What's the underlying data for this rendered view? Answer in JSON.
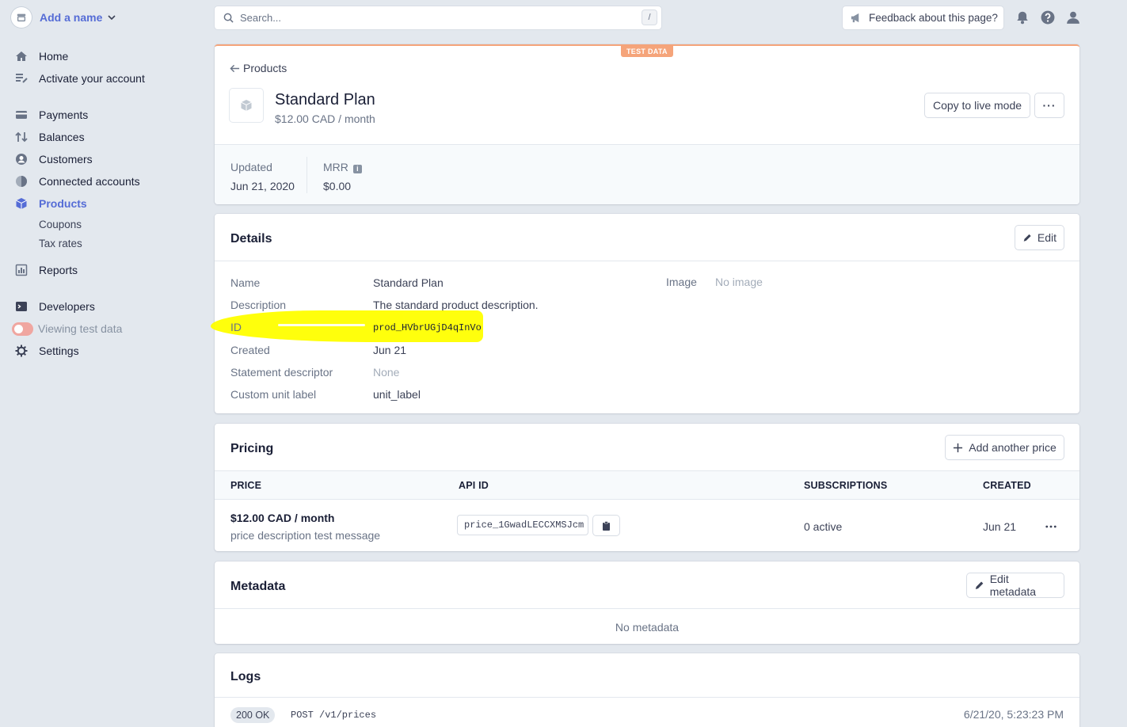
{
  "sidebar": {
    "account_name": "Add a name",
    "items": [
      {
        "label": "Home"
      },
      {
        "label": "Activate your account"
      },
      {
        "label": "Payments"
      },
      {
        "label": "Balances"
      },
      {
        "label": "Customers"
      },
      {
        "label": "Connected accounts"
      },
      {
        "label": "Products"
      },
      {
        "label": "Coupons"
      },
      {
        "label": "Tax rates"
      },
      {
        "label": "Reports"
      },
      {
        "label": "Developers"
      },
      {
        "label": "Viewing test data"
      },
      {
        "label": "Settings"
      }
    ]
  },
  "topbar": {
    "search_placeholder": "Search...",
    "search_shortcut": "/",
    "feedback_label": "Feedback about this page?"
  },
  "header": {
    "badge": "TEST DATA",
    "back_label": "Products",
    "title": "Standard Plan",
    "subtitle": "$12.00 CAD / month",
    "copy_live_label": "Copy to live mode",
    "more_label": "···",
    "updated_label": "Updated",
    "updated_value": "Jun 21, 2020",
    "mrr_label": "MRR",
    "mrr_value": "$0.00"
  },
  "details": {
    "title": "Details",
    "edit_label": "Edit",
    "rows": [
      {
        "label": "Name",
        "value": "Standard Plan"
      },
      {
        "label": "Description",
        "value": "The standard product description."
      },
      {
        "label": "ID",
        "value": "prod_HVbrUGjD4qInVo"
      },
      {
        "label": "Created",
        "value": "Jun 21"
      },
      {
        "label": "Statement descriptor",
        "value": "None"
      },
      {
        "label": "Custom unit label",
        "value": "unit_label"
      }
    ],
    "image_label": "Image",
    "image_value": "No image"
  },
  "pricing": {
    "title": "Pricing",
    "add_label": "Add another price",
    "columns": [
      "PRICE",
      "API ID",
      "SUBSCRIPTIONS",
      "CREATED"
    ],
    "rows": [
      {
        "price": "$12.00 CAD / month",
        "description": "price description test message",
        "api_id": "price_1GwadLECCXMSJcm",
        "subscriptions": "0 active",
        "created": "Jun 21"
      }
    ]
  },
  "metadata": {
    "title": "Metadata",
    "edit_label": "Edit metadata",
    "empty": "No metadata"
  },
  "logs": {
    "title": "Logs",
    "entries": [
      {
        "status": "200 OK",
        "request": "POST /v1/prices",
        "time": "6/21/20, 5:23:23 PM"
      }
    ]
  },
  "colors": {
    "accent": "#556cd6",
    "test_badge": "#f5a47a",
    "highlight": "#ffff00",
    "background": "#e3e8ee"
  }
}
